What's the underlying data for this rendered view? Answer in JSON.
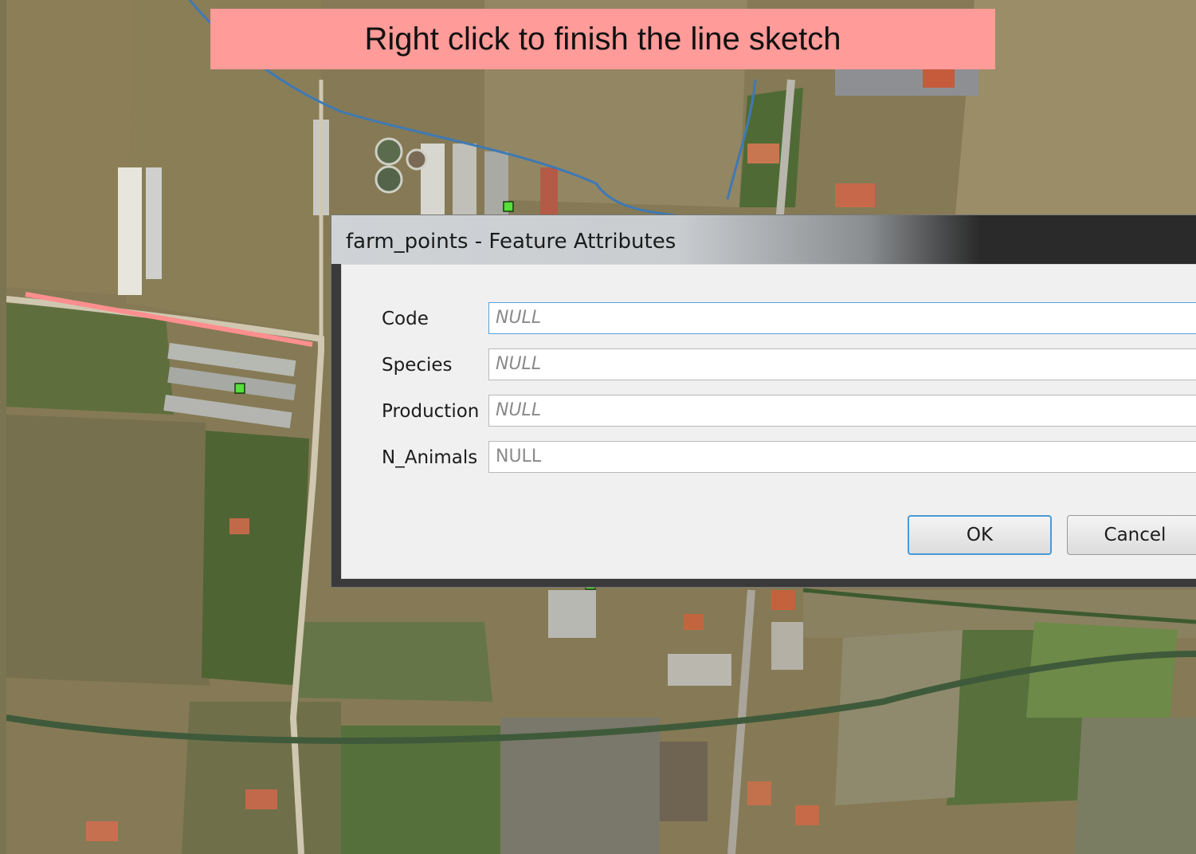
{
  "banner": {
    "text": "Right click to finish the line sketch"
  },
  "dialog": {
    "title": "farm_points - Feature Attributes",
    "fields": [
      {
        "label": "Code",
        "value": "NULL"
      },
      {
        "label": "Species",
        "value": "NULL"
      },
      {
        "label": "Production",
        "value": "NULL"
      },
      {
        "label": "N_Animals",
        "value": "NULL"
      }
    ],
    "ok_label": "OK",
    "cancel_label": "Cancel"
  },
  "colors": {
    "sketch_line": "#ff8f8f",
    "point_marker": "#55e03a",
    "banner": "#ff9b98",
    "focus_border": "#4a9ad8"
  }
}
